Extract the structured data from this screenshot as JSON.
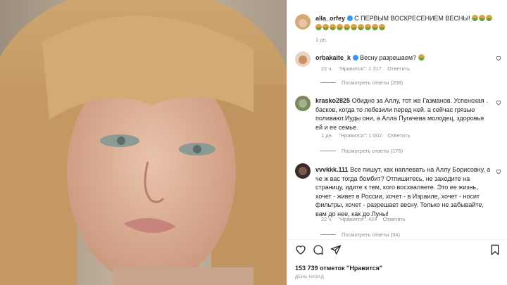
{
  "post": {
    "author": "alla_orfey",
    "caption": "С ПЕРВЫМ ВОСКРЕСЕНИЕМ ВЕСНЫ!",
    "time": "1 дн.",
    "likes": "153 739 отметок \"Нравится\"",
    "date": "ДЕНЬ НАЗАД"
  },
  "comments": [
    {
      "user": "orbakaite_k",
      "text": "Весну разрешаем?",
      "time": "22 ч.",
      "likes": "\"Нравится\": 1 317",
      "reply": "Ответить",
      "views": "Посмотреть ответы (208)"
    },
    {
      "user": "krasko2825",
      "text": "Обидно за Аллу, тот же Газманов. Успенская . басков, когда то лебезили перед ней. а сейчас грязью поливают.Иуды они, а Алла Пугачева молодец, здоровья ей и ее семье.",
      "time": "1 дн.",
      "likes": "\"Нравится\": 1 002",
      "reply": "Ответить",
      "views": "Посмотреть ответы (176)"
    },
    {
      "user": "vvvkkk.111",
      "text": "Все пишут, как наплевать на Аллу Борисовну, а че ж вас тогда бомбит? Отпишитесь, не заходите на страницу, идите к тем, кого восхваляете. Это ее жизнь, хочет - живет в России, хочет - в Израиле, хочет - носит фильтры, хочет - разрешает весну. Только не забывайте, вам до нее, как до Луны!",
      "time": "22 ч.",
      "likes": "\"Нравится\": 424",
      "reply": "Ответить",
      "views": "Посмотреть ответы (34)"
    }
  ],
  "colors": {
    "verified": "#3897f0",
    "muted": "#8e8e8e",
    "text": "#262626"
  },
  "icons": [
    "heart-icon",
    "comment-icon",
    "share-icon",
    "bookmark-icon",
    "verified-icon"
  ]
}
